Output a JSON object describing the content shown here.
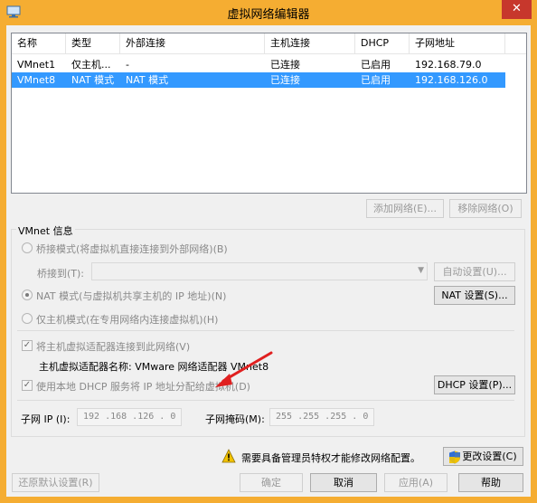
{
  "window": {
    "title": "虚拟网络编辑器",
    "close_glyph": "✕"
  },
  "table": {
    "columns": [
      "名称",
      "类型",
      "外部连接",
      "主机连接",
      "DHCP",
      "子网地址"
    ],
    "rows": [
      {
        "name": "VMnet1",
        "type": "仅主机...",
        "external": "-",
        "host": "已连接",
        "dhcp": "已启用",
        "subnet": "192.168.79.0",
        "selected": false
      },
      {
        "name": "VMnet8",
        "type": "NAT 模式",
        "external": "NAT 模式",
        "host": "已连接",
        "dhcp": "已启用",
        "subnet": "192.168.126.0",
        "selected": true
      }
    ]
  },
  "list_buttons": {
    "add": "添加网络(E)...",
    "remove": "移除网络(O)"
  },
  "vmnet_info": {
    "label": "VMnet 信息",
    "bridged": "桥接模式(将虚拟机直接连接到外部网络)(B)",
    "bridge_to_label": "桥接到(T):",
    "auto_settings": "自动设置(U)...",
    "nat": "NAT 模式(与虚拟机共享主机的 IP 地址)(N)",
    "nat_settings": "NAT 设置(S)...",
    "host_only": "仅主机模式(在专用网络内连接虚拟机)(H)",
    "connect_adapter": "将主机虚拟适配器连接到此网络(V)",
    "adapter_name": "主机虚拟适配器名称: VMware 网络适配器 VMnet8",
    "use_dhcp": "使用本地 DHCP 服务将 IP 地址分配给虚拟机(D)",
    "dhcp_settings": "DHCP 设置(P)...",
    "subnet_ip_label": "子网 IP (I):",
    "subnet_ip": "192 .168 .126 . 0",
    "subnet_mask_label": "子网掩码(M):",
    "subnet_mask": "255 .255 .255 . 0"
  },
  "admin_notice": "需要具备管理员特权才能修改网络配置。",
  "change_settings": "更改设置(C)",
  "footer": {
    "restore": "还原默认设置(R)",
    "ok": "确定",
    "cancel": "取消",
    "apply": "应用(A)",
    "help": "帮助"
  },
  "colors": {
    "frame": "#f5ad32",
    "selection": "#3399ff",
    "close": "#c7372c",
    "annotation_arrow": "#e02020"
  }
}
